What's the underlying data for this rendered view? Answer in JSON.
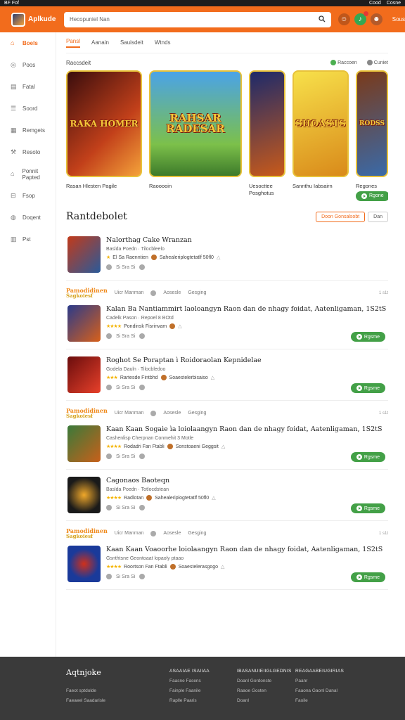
{
  "statusbar": {
    "left": "BF Fof",
    "right1": "Cood",
    "right2": "Cosne"
  },
  "header": {
    "logo_text": "Aplkude",
    "search_placeholder": "Hecopuniel Nan",
    "menu_label": "Sous"
  },
  "sidebar": {
    "items": [
      {
        "label": "Boels",
        "icon": "home-icon",
        "glyph": "⌂",
        "active": true
      },
      {
        "label": "Poos",
        "icon": "games-icon",
        "glyph": "◎",
        "active": false
      },
      {
        "label": "Fatal",
        "icon": "apps-icon",
        "glyph": "▤",
        "active": false
      },
      {
        "label": "Soord",
        "icon": "list-icon",
        "glyph": "☰",
        "active": false
      },
      {
        "label": "Remgets",
        "icon": "rankings-icon",
        "glyph": "▦",
        "active": false
      },
      {
        "label": "Resoto",
        "icon": "tools-icon",
        "glyph": "⚒",
        "active": false
      },
      {
        "label": "Ponnit Papted",
        "icon": "bank-icon",
        "glyph": "⌂",
        "active": false
      },
      {
        "label": "Fsop",
        "icon": "bookmark-icon",
        "glyph": "⊟",
        "active": false
      },
      {
        "label": "Doqent",
        "icon": "circle-icon",
        "glyph": "◍",
        "active": false
      },
      {
        "label": "Pst",
        "icon": "extra-icon",
        "glyph": "▥",
        "active": false
      }
    ]
  },
  "tabs": [
    {
      "label": "Pansl",
      "active": true
    },
    {
      "label": "Aanain",
      "active": false
    },
    {
      "label": "Sauisdeit",
      "active": false
    },
    {
      "label": "Wtnds",
      "active": false
    }
  ],
  "featured": {
    "label": "Raccsdeit",
    "action1": "Raccoen",
    "action2": "Cuniet",
    "cards": [
      {
        "art": "RAKA HOMER",
        "caption": "Rasan Hlesten Pagile",
        "caption2": "",
        "button": ""
      },
      {
        "art": "RAHSAR RADESAR",
        "caption": "Raooooin",
        "caption2": "",
        "button": ""
      },
      {
        "art": "",
        "caption": "Uesocttee",
        "caption2": "Posghotus",
        "button": ""
      },
      {
        "art": "SHOASTS",
        "caption": "Sannthu Iabsairn",
        "caption2": "",
        "button": ""
      },
      {
        "art": "RODSS",
        "caption": "Regones",
        "caption2": "",
        "button": "Rgone"
      }
    ]
  },
  "section": {
    "title": "Rantdebolet",
    "btn_primary": "Doon Gonsalsobt",
    "btn_secondary": "Dan"
  },
  "entries": [
    {
      "head": null,
      "title": "Nalorthag Cake Wranzan",
      "sub": "Baslda Poedn · Tilocbleelo",
      "rating_stars": "★",
      "rating_text": "El  Sa Raenntien",
      "meta_extra": "Sahealeriplogtetatlf 50fl0",
      "stats": "Si Sra Si",
      "button": null
    },
    {
      "head": {
        "brand": "Pamodidinen",
        "brand2": "Sagkoiesf",
        "user": "Uicr Manman",
        "label": "Aosesle",
        "label2": "Gesging",
        "time": "1 s1t"
      },
      "title": "Kalan Ba Nantiammirt laoloangyn Raon dan de nhagy foidat, Aatenligaman, 1S2tS",
      "sub": "Cadelk Pason · Repoel 8 BOtd",
      "rating_stars": "★★★★",
      "rating_text": "Pondinsk Fisrinvam",
      "meta_extra": "",
      "stats": "Si Sra Si",
      "button": "Rgsme"
    },
    {
      "head": null,
      "title": "Roghot Se Poraptan ì Roidoraolan Kepnidelae",
      "sub": "Godela Dauln · Tilocbledoo",
      "rating_stars": "★★★",
      "rating_text": "Rartesde Fintbhd",
      "meta_extra": "Soaestelerbisaiso",
      "stats": "Si Sra Si",
      "button": "Rgsme"
    },
    {
      "head": {
        "brand": "Pamodidinen",
        "brand2": "Sagkoiesf",
        "user": "Uicr Manman",
        "label": "Aosesle",
        "label2": "Gesging",
        "time": "1 s1t"
      },
      "title": "Kaan Kaan Sogaie ìa loiolaangyn Raon dan de nhagy foidat, Aatenligaman, 1S2tS",
      "sub": "Cashenlisp Cherpnan Conmehit 3 Motle",
      "rating_stars": "★★★★",
      "rating_text": "Rodadri Fan Ftabli",
      "meta_extra": "Sonstoaeni Geggsit",
      "stats": "Si Sra Si",
      "button": "Rgsme"
    },
    {
      "head": null,
      "title": "Cagonaos Baoteqn",
      "sub": "Baslda Poedn · Totlocdstean",
      "rating_stars": "★★★★",
      "rating_text": "Radlotan",
      "meta_extra": "Sahealeriplogtetatlf 50fl0",
      "stats": "Si Sra Si",
      "button": "Rgsme"
    },
    {
      "head": {
        "brand": "Pamodidinen",
        "brand2": "Sagkoiesf",
        "user": "Uicr Manman",
        "label": "Aosesle",
        "label2": "Gesging",
        "time": "1 s1t"
      },
      "title": "Kaan Kaan Voaoorhe loiolaangyn Raon dan de nhagy foidat, Aatenligaman, 1S2tS",
      "sub": "Gsnthtsne Geontoaat lopaoly ptaao",
      "rating_stars": "★★★★",
      "rating_text": "Roortson Fan Ftabli",
      "meta_extra": "Soaestelerasgogo",
      "stats": "Si Sra Si",
      "button": "Rgsme"
    }
  ],
  "footer": {
    "brand": "Aqtnjoke",
    "left_lines": [
      "Faeot sptdolde",
      "Faeaeel Saadarisle"
    ],
    "cols": [
      {
        "h": "ASAAIAE ISAIIAA",
        "lines": [
          "Faasne Fasens",
          "Fainple Faanile",
          "Raplle Paaris"
        ]
      },
      {
        "h": "IBASANUIEIIGLGEDNIS",
        "lines": [
          "Doanl Gordonste",
          "Raaoe Gosten",
          "Doanl"
        ]
      },
      {
        "h": "REAGAABEIUGIRIAS",
        "lines": [
          "Paanr",
          "Faaona Gaonl Danal",
          "Faoile"
        ]
      }
    ]
  },
  "colors": {
    "brand": "#f26c1c",
    "green": "#43a047",
    "footer": "#3a3a3a"
  }
}
